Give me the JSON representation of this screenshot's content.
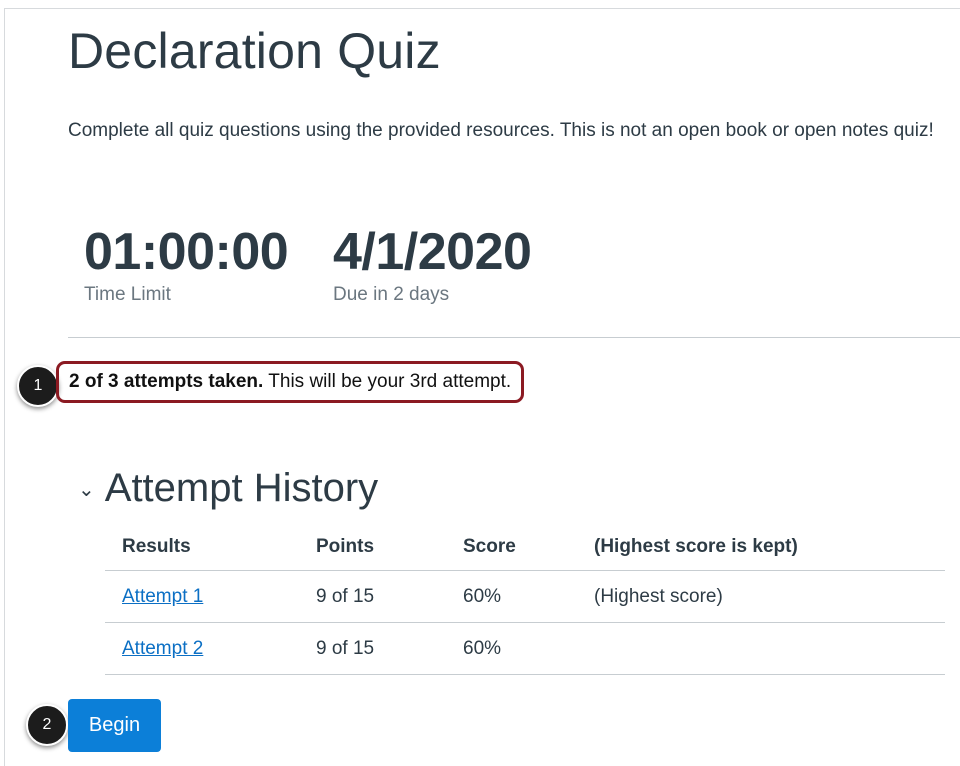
{
  "quiz": {
    "title": "Declaration Quiz",
    "description": "Complete all quiz questions using the provided resources. This is not an open book or open notes quiz!"
  },
  "stats": {
    "time_limit_value": "01:00:00",
    "time_limit_label": "Time Limit",
    "due_value": "4/1/2020",
    "due_label": "Due in 2 days"
  },
  "attempts": {
    "taken_bold": "2 of 3 attempts taken.",
    "next_text": "This will be your 3rd attempt."
  },
  "callouts": {
    "one": "1",
    "two": "2"
  },
  "history": {
    "toggle_icon": "chevron-down-icon",
    "title": "Attempt History",
    "columns": [
      "Results",
      "Points",
      "Score",
      "(Highest score is kept)"
    ],
    "rows": [
      {
        "result": "Attempt 1",
        "points": "9 of 15",
        "score": "60%",
        "note": "(Highest score)"
      },
      {
        "result": "Attempt 2",
        "points": "9 of 15",
        "score": "60%",
        "note": ""
      }
    ]
  },
  "actions": {
    "begin_label": "Begin"
  },
  "colors": {
    "accent": "#0c7fd8",
    "link": "#0b6fc4",
    "highlight_border": "#8b1a22",
    "text": "#2d3b45",
    "muted": "#6b7780"
  }
}
